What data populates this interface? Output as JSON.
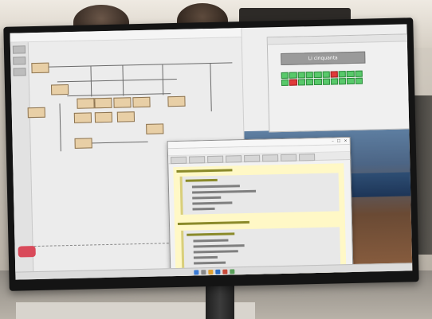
{
  "game": {
    "banner_text": "Li cinquanta",
    "grid": [
      [
        "g",
        "g",
        "g",
        "g",
        "g",
        "g",
        "r",
        "g",
        "g",
        "g"
      ],
      [
        "g",
        "r",
        "g",
        "g",
        "g",
        "g",
        "g",
        "g",
        "g",
        "g"
      ]
    ],
    "colors": {
      "green": "#58c96a",
      "red": "#e03a3a",
      "banner": "#9a9a9a"
    }
  },
  "editor": {
    "code_background": "#fff8c6"
  },
  "badge": {
    "color": "#d94a5a"
  },
  "icons": [
    "close-icon",
    "minimize-icon",
    "maximize-icon",
    "start-icon",
    "search-icon"
  ]
}
